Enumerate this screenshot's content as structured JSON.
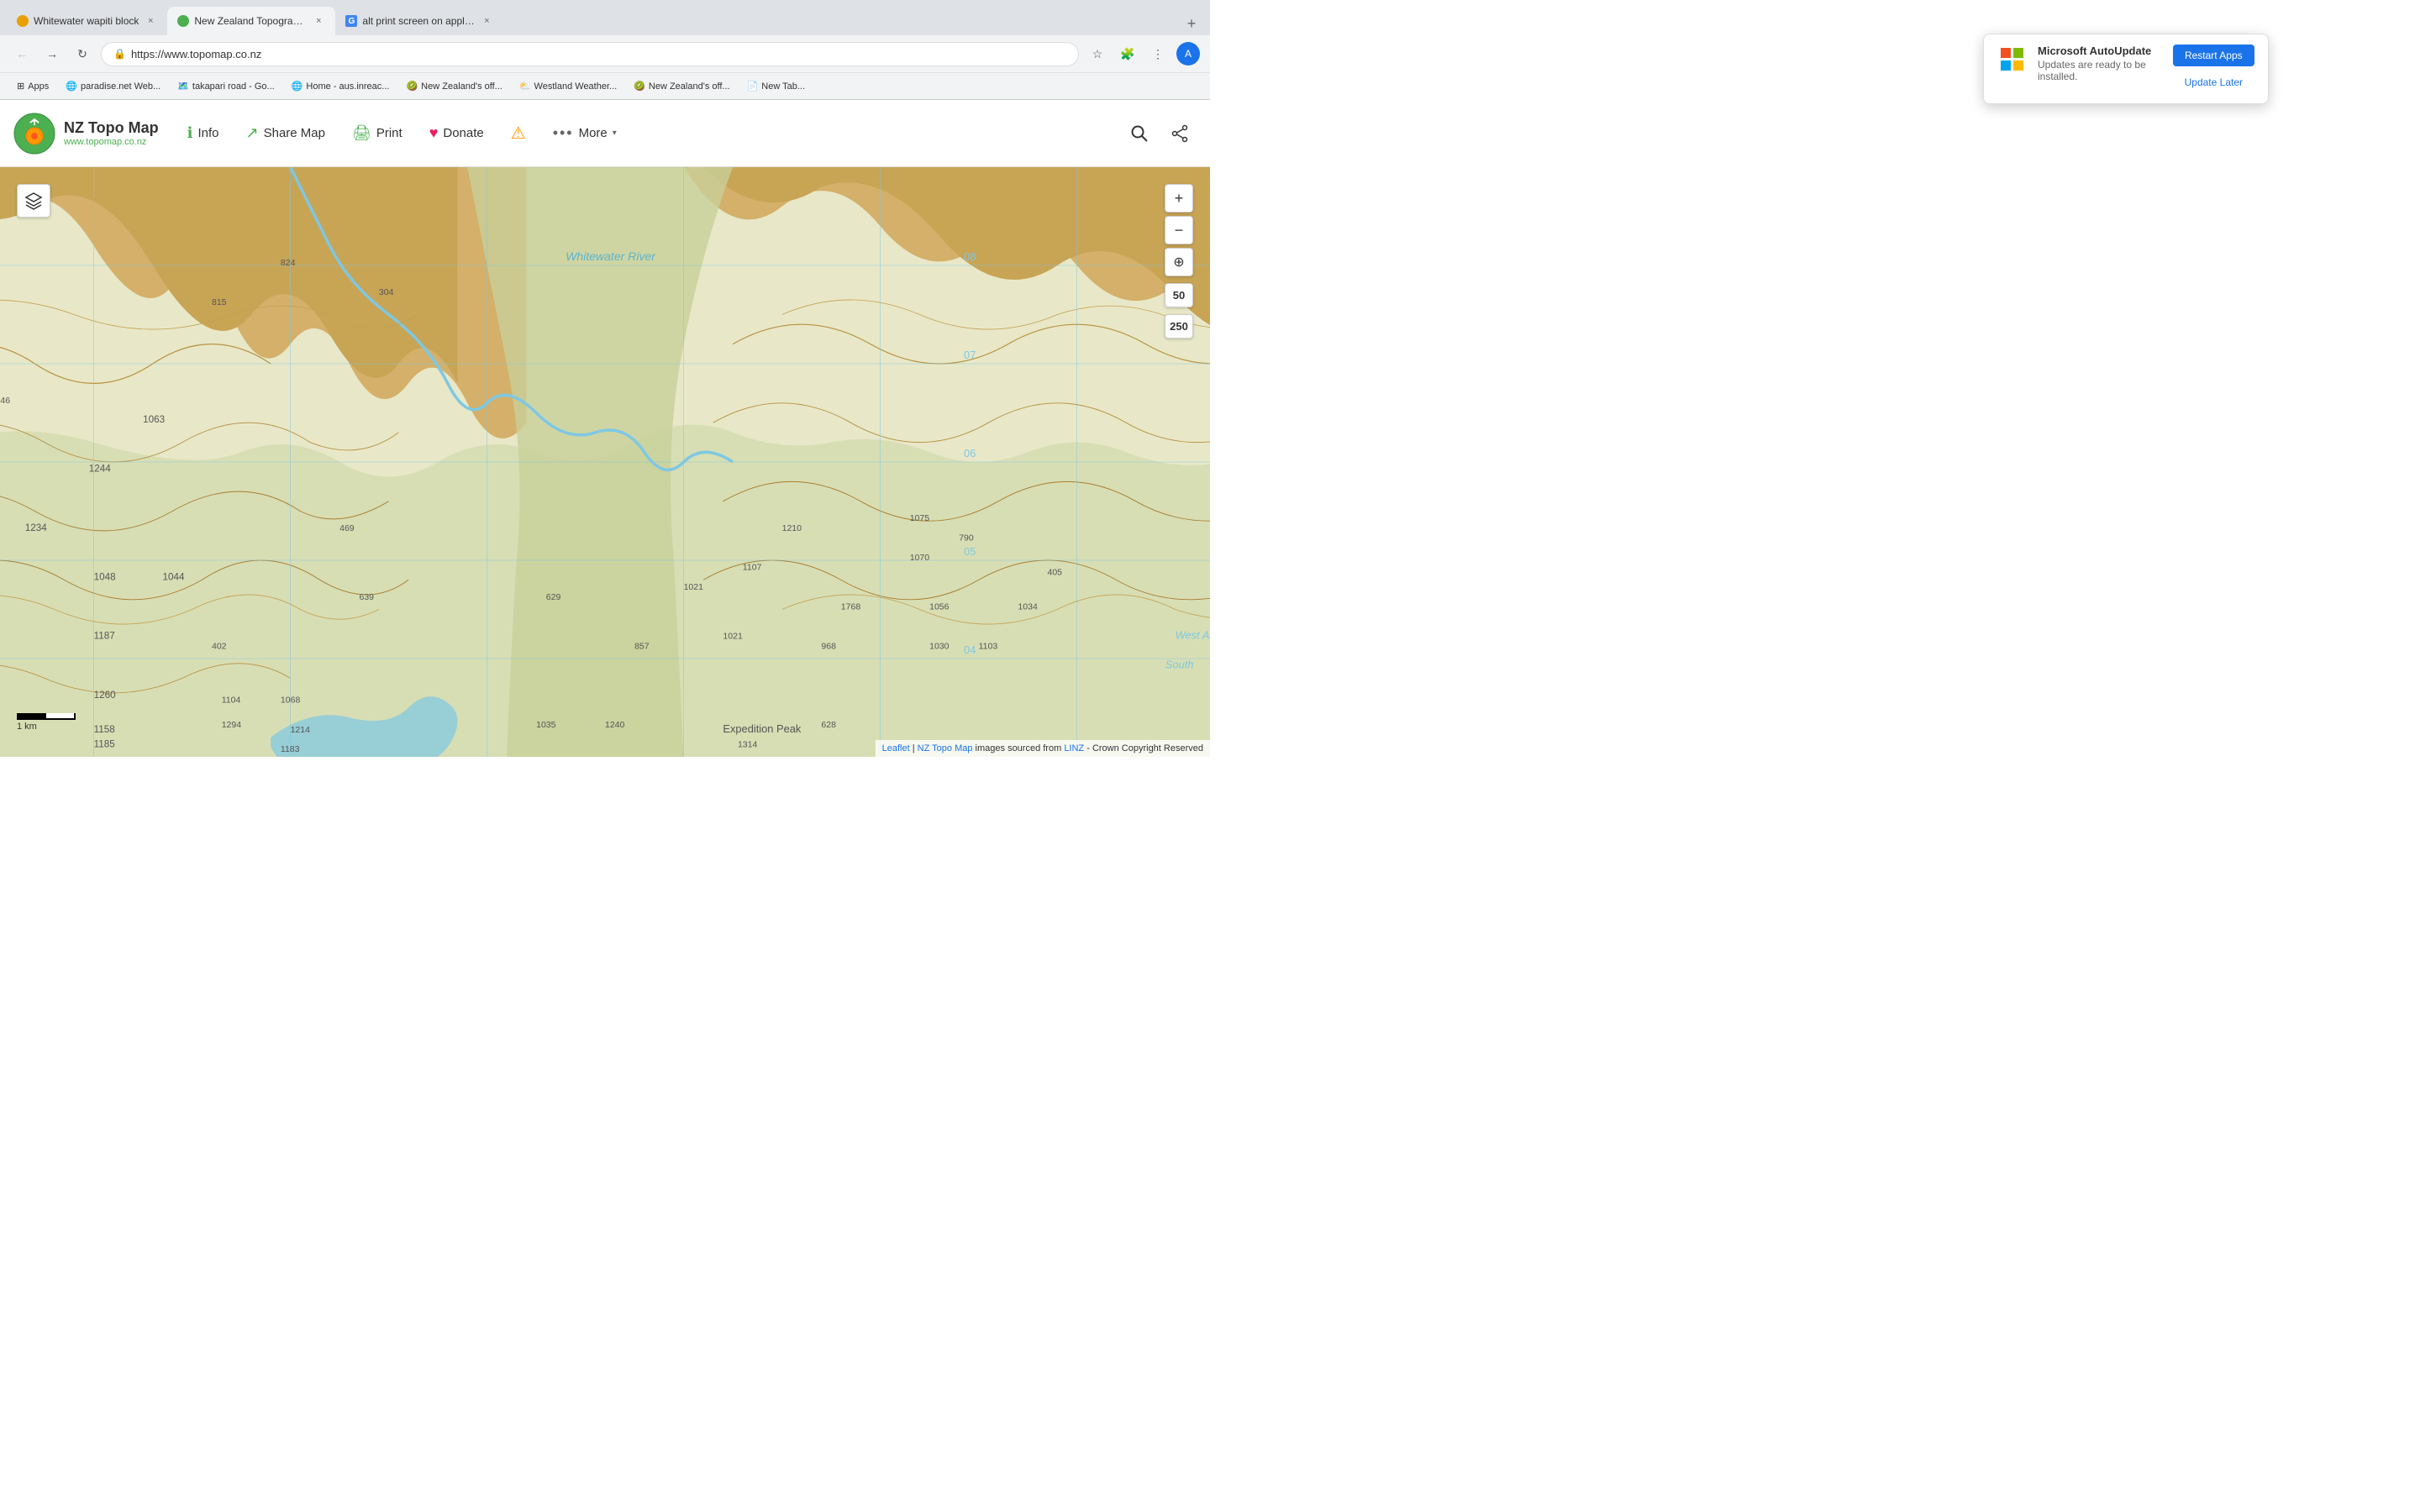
{
  "browser": {
    "tabs": [
      {
        "id": "tab1",
        "title": "Whitewater wapiti block",
        "favicon_type": "ww",
        "active": false
      },
      {
        "id": "tab2",
        "title": "New Zealand Topographic Map",
        "favicon_type": "nz",
        "active": true
      },
      {
        "id": "tab3",
        "title": "alt print screen on apple ke...",
        "favicon_type": "g",
        "active": false
      }
    ],
    "url": "https://www.topomap.co.nz",
    "bookmarks": [
      {
        "label": "Apps"
      },
      {
        "label": "paradise.net Web..."
      },
      {
        "label": "takapari road - Go..."
      },
      {
        "label": "Home - aus.inreac..."
      },
      {
        "label": "New Zealand's off..."
      },
      {
        "label": "Westland Weather..."
      },
      {
        "label": "New Zealand's off..."
      },
      {
        "label": "New Tab..."
      }
    ]
  },
  "header": {
    "logo_name": "NZ Topo Map",
    "logo_url": "www.topomap.co.nz",
    "nav": [
      {
        "id": "info",
        "label": "Info",
        "icon": "ℹ️"
      },
      {
        "id": "share",
        "label": "Share Map",
        "icon": "🔗"
      },
      {
        "id": "print",
        "label": "Print",
        "icon": "🖨️"
      },
      {
        "id": "donate",
        "label": "Donate",
        "icon": "❤️"
      },
      {
        "id": "alert",
        "label": "",
        "icon": "⚠️"
      },
      {
        "id": "more",
        "label": "More",
        "icon": "···"
      }
    ]
  },
  "map": {
    "zoom_in_label": "+",
    "zoom_out_label": "−",
    "scale_50": "50",
    "scale_250": "250",
    "scale_bar_label": "1 km",
    "attribution": "Leaflet | NZ Topo Map images sourced from LINZ - Crown Copyright Reserved",
    "water_label": "Whitewater River",
    "expedition_label": "Expedition Peak",
    "west_arm_label": "West Arm",
    "south_label": "South"
  },
  "notification": {
    "app_name": "Microsoft AutoUpdate",
    "body": "Updates are ready to be installed.",
    "btn_later": "Update Later",
    "btn_restart": "Restart Apps"
  }
}
